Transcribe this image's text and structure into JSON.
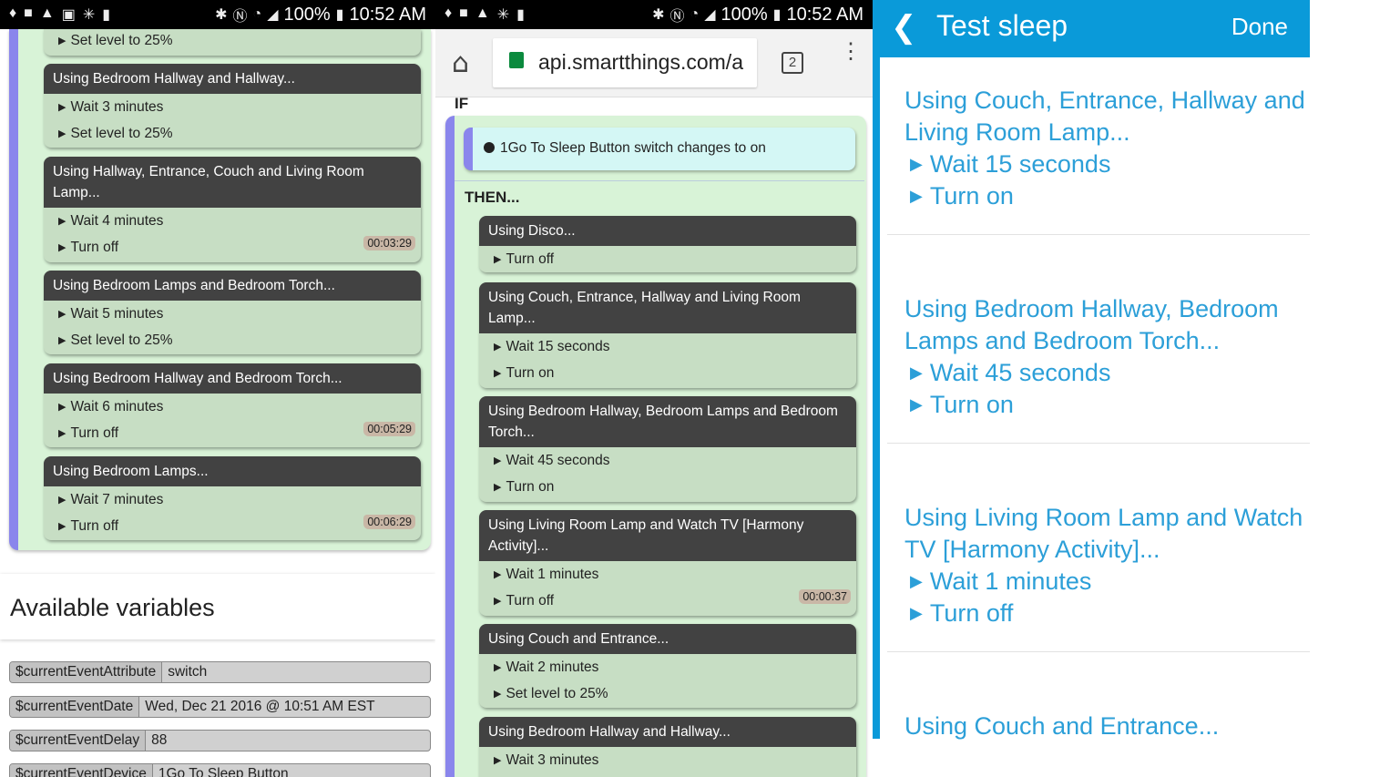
{
  "status": {
    "battery": "100%",
    "time": "10:52 AM"
  },
  "p1": {
    "top_line": "Set level to 25%",
    "blocks": [
      {
        "header": "Using Bedroom Hallway and Hallway...",
        "l1": "Wait 3 minutes",
        "l2": "Set level to 25%",
        "timer": ""
      },
      {
        "header": "Using Hallway, Entrance, Couch and Living Room Lamp...",
        "l1": "Wait 4 minutes",
        "l2": "Turn off",
        "timer": "00:03:29"
      },
      {
        "header": "Using Bedroom Lamps and Bedroom Torch...",
        "l1": "Wait 5 minutes",
        "l2": "Set level to 25%",
        "timer": ""
      },
      {
        "header": "Using Bedroom Hallway and Bedroom Torch...",
        "l1": "Wait 6 minutes",
        "l2": "Turn off",
        "timer": "00:05:29"
      },
      {
        "header": "Using Bedroom Lamps...",
        "l1": "Wait 7 minutes",
        "l2": "Turn off",
        "timer": "00:06:29"
      }
    ],
    "vars_title": "Available variables",
    "vars": [
      {
        "k": "$currentEventAttribute",
        "v": "switch"
      },
      {
        "k": "$currentEventDate",
        "v": "Wed, Dec 21 2016 @ 10:51 AM EST"
      },
      {
        "k": "$currentEventDelay",
        "v": "88"
      },
      {
        "k": "$currentEventDevice",
        "v": "1Go To Sleep Button"
      }
    ]
  },
  "p2": {
    "url": "api.smartthings.com/a",
    "tabs": "2",
    "if_label": "IF",
    "condition": "1Go To Sleep Button switch changes to on",
    "then_label": "THEN...",
    "blocks": [
      {
        "header": "Using Disco...",
        "l1": "Turn off",
        "l2": "",
        "timer": ""
      },
      {
        "header": "Using Couch, Entrance, Hallway and Living Room Lamp...",
        "l1": "Wait 15 seconds",
        "l2": "Turn on",
        "timer": ""
      },
      {
        "header": "Using Bedroom Hallway, Bedroom Lamps and Bedroom Torch...",
        "l1": "Wait 45 seconds",
        "l2": "Turn on",
        "timer": ""
      },
      {
        "header": "Using Living Room Lamp and Watch TV [Harmony Activity]...",
        "l1": "Wait 1 minutes",
        "l2": "Turn off",
        "timer": "00:00:37"
      },
      {
        "header": "Using Couch and Entrance...",
        "l1": "Wait 2 minutes",
        "l2": "Set level to 25%",
        "timer": ""
      },
      {
        "header": "Using Bedroom Hallway and Hallway...",
        "l1": "Wait 3 minutes",
        "l2": "",
        "timer": ""
      }
    ]
  },
  "p3": {
    "title": "Test sleep",
    "done": "Done",
    "items": [
      {
        "t": "Using Couch, Entrance, Hallway and Living Room Lamp...",
        "s1": "Wait 15 seconds",
        "s2": "Turn on"
      },
      {
        "t": "Using Bedroom Hallway, Bedroom Lamps and Bedroom Torch...",
        "s1": "Wait 45 seconds",
        "s2": "Turn on"
      },
      {
        "t": "Using Living Room Lamp and Watch TV [Harmony Activity]...",
        "s1": "Wait 1 minutes",
        "s2": "Turn off"
      },
      {
        "t": "Using Couch and Entrance...",
        "s1": "",
        "s2": ""
      }
    ]
  },
  "colors": {
    "accent": "#0a9ad9",
    "rail": "#8a86ec",
    "green_bg": "#d8f3d7",
    "block_bg": "#c7dec4",
    "header_bg": "#424242"
  }
}
